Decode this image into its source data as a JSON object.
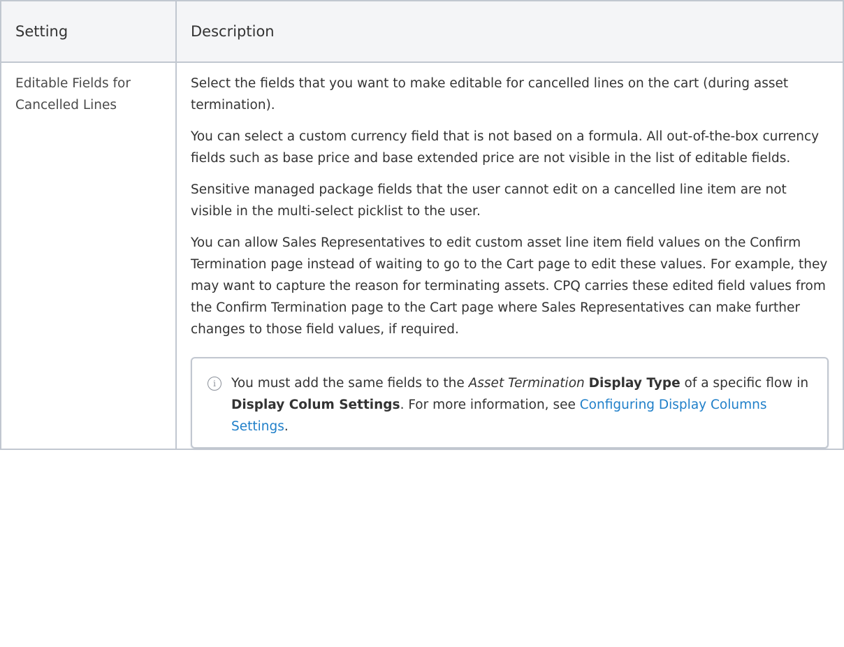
{
  "table": {
    "headers": {
      "setting": "Setting",
      "description": "Description"
    },
    "row": {
      "setting_name": "Editable Fields for Cancelled Lines",
      "paragraphs": [
        "Select the fields that you want to make editable for cancelled lines on the cart (during asset termination).",
        "You can select a custom currency field that is not based on a formula. All out-of-the-box currency fields such as base price and base extended price are not visible in the list of editable fields.",
        "Sensitive managed package fields that the user cannot edit on a cancelled line item are not visible in the multi-select picklist to the user.",
        "You can allow Sales Representatives to edit custom asset line item field values on the Confirm Termination page instead of waiting to go to the Cart page to edit these values. For example, they may want to capture the reason for terminating assets. CPQ carries these edited field values from the Confirm Termination page to the Cart page where Sales Representatives can make further changes to those field values, if required."
      ],
      "info_note": {
        "icon": "info-icon",
        "text_1": "You must add the same fields to the ",
        "italic_1": "Asset Termination",
        "text_2": " ",
        "bold_1": "Display Type",
        "text_3": " of a specific flow in ",
        "bold_2": "Display Colum Settings",
        "text_4": ". For more information, see ",
        "link": "Configuring Display Columns Settings",
        "text_5": "."
      }
    }
  },
  "colors": {
    "border": "#c1c7d0",
    "header_bg": "#f4f5f7",
    "link": "#1f7fc9",
    "text": "#333333"
  }
}
